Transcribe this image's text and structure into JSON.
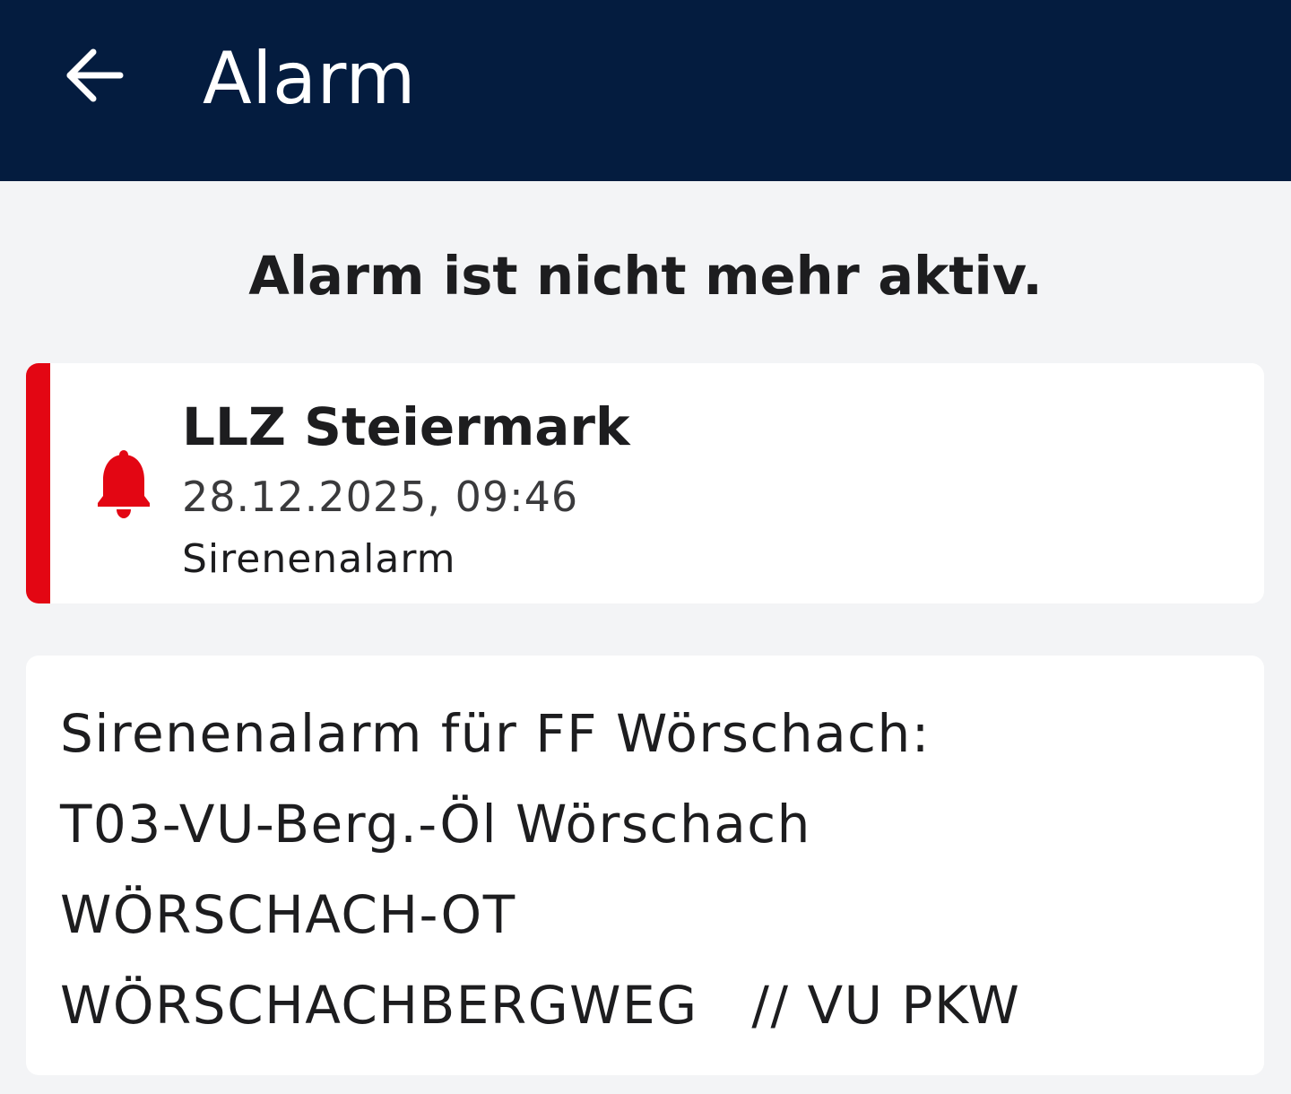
{
  "app_bar": {
    "title": "Alarm",
    "back_icon": "arrow-left-icon",
    "background": "#041c3f"
  },
  "status_text": "Alarm ist nicht mehr aktiv.",
  "alarm_card": {
    "accent_color": "#e30613",
    "icon": "bell-icon",
    "title": "LLZ Steiermark",
    "datetime": "28.12.2025, 09:46",
    "type": "Sirenenalarm"
  },
  "message": {
    "lines": [
      "Sirenenalarm für FF Wörschach:",
      "T03-VU-Berg.-Öl Wörschach",
      "WÖRSCHACH-OT",
      "WÖRSCHACHBERGWEG   // VU PKW"
    ]
  }
}
